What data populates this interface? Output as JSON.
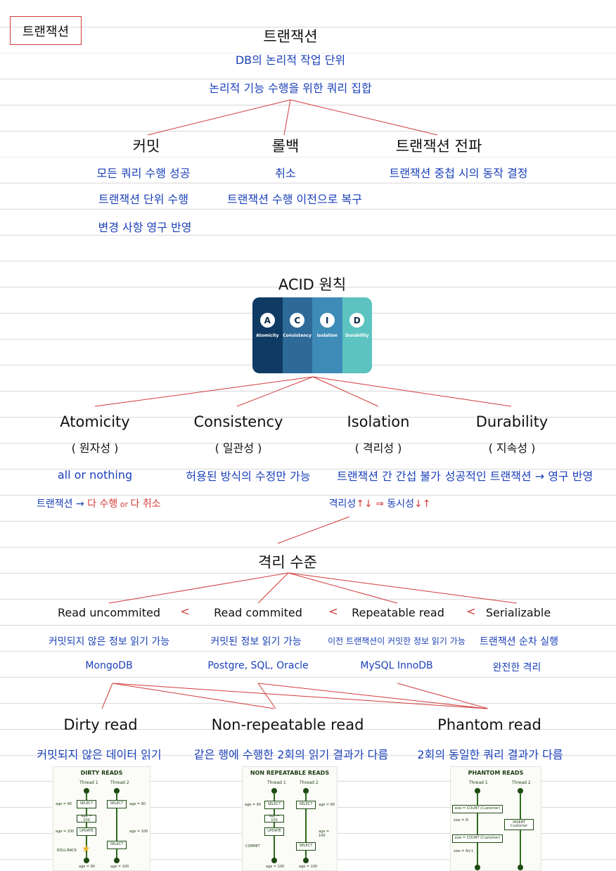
{
  "tag": "트랜잭션",
  "title": "트랜잭션",
  "definition": [
    "DB의 논리적 작업 단위",
    "논리적 기능 수행을 위한 쿼리 집합"
  ],
  "branches": [
    {
      "name": "커밋",
      "lines": [
        "모든 쿼리 수행 성공",
        "트랜잭션 단위 수행",
        "변경 사항 영구 반영"
      ]
    },
    {
      "name": "롤백",
      "lines": [
        "취소",
        "트랜잭션 수행 이전으로 복구"
      ]
    },
    {
      "name": "트랜잭션 전파",
      "lines": [
        "트랜잭션 중첩 시의 동작 결정"
      ]
    }
  ],
  "acid_title": "ACID 원칙",
  "acid_card": {
    "letters": [
      "A",
      "C",
      "I",
      "D"
    ],
    "labels": [
      "Atomicity",
      "Consistency",
      "Isolation",
      "Durability"
    ],
    "colors": [
      "#0f3a63",
      "#2d6a98",
      "#3e8bb7",
      "#5cc3c0"
    ]
  },
  "properties": [
    {
      "en": "Atomicity",
      "ko": "( 원자성 )",
      "desc": "all or nothing"
    },
    {
      "en": "Consistency",
      "ko": "( 일관성 )",
      "desc": "허용된 방식의 수정만 가능"
    },
    {
      "en": "Isolation",
      "ko": "( 격리성 )",
      "desc": "트랜잭션 간 간섭 불가"
    },
    {
      "en": "Durability",
      "ko": "( 지속성 )",
      "desc": "성공적인 트랜잭션 → 영구 반영"
    }
  ],
  "atomicity_note": {
    "a": "트랜잭션 → ",
    "b": "다 수행",
    "c": " or ",
    "d": "다 취소"
  },
  "isolation_note": {
    "a": "격리성",
    "arrow1": "↑↓",
    "mid": " ⇒ ",
    "b": "동시성",
    "arrow2": "↓↑"
  },
  "isolation_levels_title": "격리 수준",
  "levels": [
    {
      "name": "Read uncommited",
      "desc": "커밋되지 않은 정보 읽기 가능",
      "db": "MongoDB"
    },
    {
      "name": "Read commited",
      "desc": "커밋된 정보 읽기 가능",
      "db": "Postgre, SQL, Oracle"
    },
    {
      "name": "Repeatable read",
      "desc": "이전 트랜잭션이 커밋한 정보 읽기 가능",
      "db": "MySQL InnoDB"
    },
    {
      "name": "Serializable",
      "desc": "트랜잭션 순차 실행",
      "db": "완전한 격리"
    }
  ],
  "lt": "<",
  "phenomena": [
    {
      "name": "Dirty read",
      "desc": "커밋되지 않은 데이터 읽기"
    },
    {
      "name": "Non-repeatable read",
      "desc": "같은 행에 수행한 2회의 읽기 결과가 다름"
    },
    {
      "name": "Phantom read",
      "desc": "2회의 동일한 쿼리 결과가 다름"
    }
  ],
  "diagrams": {
    "dirty": {
      "title": "DIRTY READS",
      "t1": "Thread 1",
      "t2": "Thread 2",
      "select": "SELECT",
      "update": "UPDATE",
      "val90": "age = 90",
      "val100": "age = 100",
      "rollback": "ROLL-BACK"
    },
    "nonrep": {
      "title": "NON REPEATABLE READS",
      "t1": "Thread 1",
      "t2": "Thread 2",
      "select": "SELECT",
      "update": "UPDATE",
      "val90": "age = 90",
      "val100": "age = 100",
      "commit": "COMMIT"
    },
    "phantom": {
      "title": "PHANTOM READS",
      "t1": "Thread 1",
      "t2": "Thread 2",
      "count": "size = COUNT (Customer)",
      "insert": "INSERT Customer",
      "n": "size = N",
      "n1": "size = N+1"
    }
  }
}
